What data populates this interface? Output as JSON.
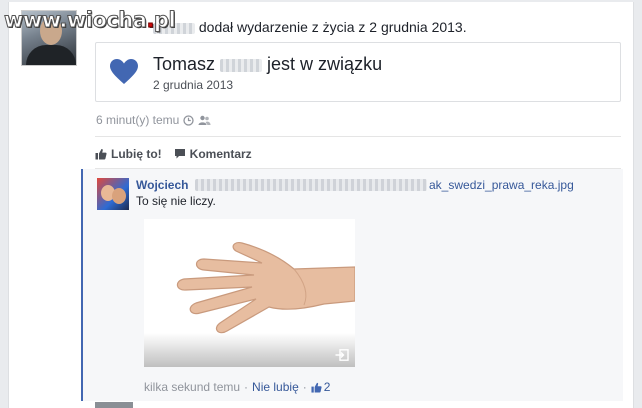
{
  "watermark": {
    "prefix": "www.wiocha",
    "dot": ".",
    "suffix": "pl"
  },
  "event": {
    "line": "dodał wydarzenie z życia z 2 grudnia 2013.",
    "card_title_first": "Tomasz",
    "card_title_rest": "jest w związku",
    "card_date": "2 grudnia 2013"
  },
  "meta": {
    "time": "6 minut(y) temu"
  },
  "actions": {
    "like_label": "Lubię to!",
    "comment_label": "Komentarz"
  },
  "comment": {
    "author": "Wojciech",
    "link": "ak_swedzi_prawa_reka.jpg",
    "text": "To się nie liczy.",
    "time": "kilka sekund temu",
    "separator": "·",
    "unlike_label": "Nie lubię",
    "separator2": "·",
    "likes": "2"
  },
  "colors": {
    "link": "#365899",
    "accent": "#4267b2",
    "meta": "#90949c"
  }
}
